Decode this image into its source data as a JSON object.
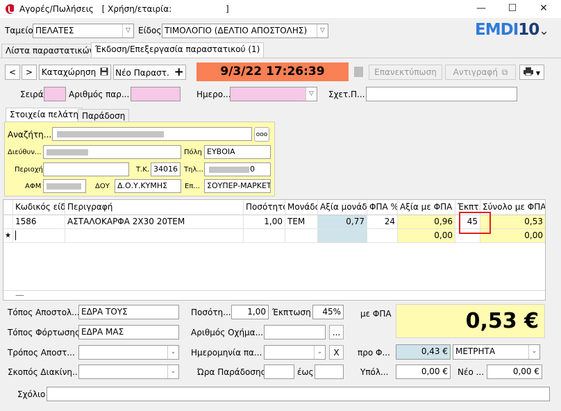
{
  "window": {
    "title": "Αγορές/Πωλήσεις",
    "subtitle": "[ Χρήση/εταιρία:",
    "subtitle_end": "]",
    "min": "—",
    "max": "☐",
    "close": "✕"
  },
  "top": {
    "cashbox_label": "Ταμείο",
    "cashbox_value": "ΠΕΛΑΤΕΣ",
    "type_label": "Είδος",
    "type_value": "ΤΙΜΟΛΟΓΙΟ (ΔΕΛΤΙΟ ΑΠΟΣΤΟΛΗΣ)",
    "logo_a": "EMDI",
    "logo_b": "10"
  },
  "tabs": {
    "list": "Λίστα παραστατικών",
    "edit": "Έκδοση/Επεξεργασία παραστατικού (1)"
  },
  "toolbar": {
    "prev": "<",
    "next": ">",
    "save": "Καταχώρηση",
    "new": "Νέο Παραστ.",
    "datetime": "9/3/22 17:26:39",
    "reprint": "Επανεκτύπωση",
    "copy": "Αντιγραφή"
  },
  "header_fields": {
    "series_label": "Σειρά",
    "number_label": "Αριθμός παρ...",
    "date_label": "Ημερο...",
    "related_label": "Σχετ.Π..."
  },
  "customer_tabs": {
    "info": "Στοιχεία πελάτη",
    "delivery": "Παράδοση"
  },
  "customer": {
    "search_label": "Αναζήτη...",
    "search_prefix": "",
    "more": "ooo",
    "address_label": "Διεύθυν...",
    "city_label": "Πόλη",
    "city_value": "ΕΥΒΟΙΑ",
    "area_label": "Περιοχή",
    "zip_label": "Τ.Κ.",
    "zip_value": "34016",
    "phone_label": "Τηλ...",
    "phone_suffix": "0",
    "afm_label": "ΑΦΜ",
    "doy_label": "ΔΟΥ",
    "doy_value": "Δ.Ο.Υ.ΚΥΜΗΣ",
    "profession_label": "Επ...",
    "profession_value": "ΣΟΥΠΕΡ-ΜΑΡΚΕΤ"
  },
  "grid": {
    "headers": [
      "Κωδικός είδους",
      "Περιγραφή",
      "Ποσότητα",
      "Μονάδα",
      "Αξία μονάδας",
      "ΦΠΑ %",
      "Αξία με ΦΠΑ",
      "Έκπτ.",
      "Σύνολο με ΦΠΑ"
    ],
    "row1": {
      "code": "1586",
      "desc": "ΑΣΤΑΛΟΚΑΡΦΑ 2Χ30  20ΤΕΜ",
      "qty": "1,00",
      "unit": "ΤΕΜ",
      "unit_price": "0,77",
      "vat": "24",
      "value_vat": "0,96",
      "discount": "45",
      "total": "0,53"
    },
    "new_row": {
      "marker": "★",
      "value_vat": "0,00",
      "total": "0,00"
    },
    "splitter": "—"
  },
  "footer": {
    "ship_from_label": "Τόπος Αποστολ...",
    "ship_from_value": "ΕΔΡΑ ΤΟΥΣ",
    "load_place_label": "Τόπος Φόρτωσης",
    "load_place_value": "ΕΔΡΑ ΜΑΣ",
    "ship_method_label": "Τρόπος Αποστ...",
    "purpose_label": "Σκοπός Διακίνη...",
    "comment_label": "Σχόλιο",
    "qty_label": "Ποσότη...",
    "qty_value": "1,00",
    "discount_label": "Έκπτωση",
    "discount_value": "45%",
    "vehicle_label": "Αριθμός Οχήμα...",
    "vehicle_btn": "...",
    "date_label": "Ημερομηνία πα...",
    "date_btn": "X",
    "delivery_time_label": "Ώρα Παράδοσης",
    "until_label": "έως",
    "with_vat_label": "με ΦΠΑ",
    "grand_total": "0,53 €",
    "pre_vat_label": "προ Φ...",
    "pre_vat_value": "0,43 €",
    "payment_value": "ΜΕΤΡΗΤΑ",
    "balance_label": "Υπόλ...",
    "balance_value": "0,00 €",
    "new_balance_label": "Νέο ...",
    "new_balance_value": "0,00 €"
  }
}
